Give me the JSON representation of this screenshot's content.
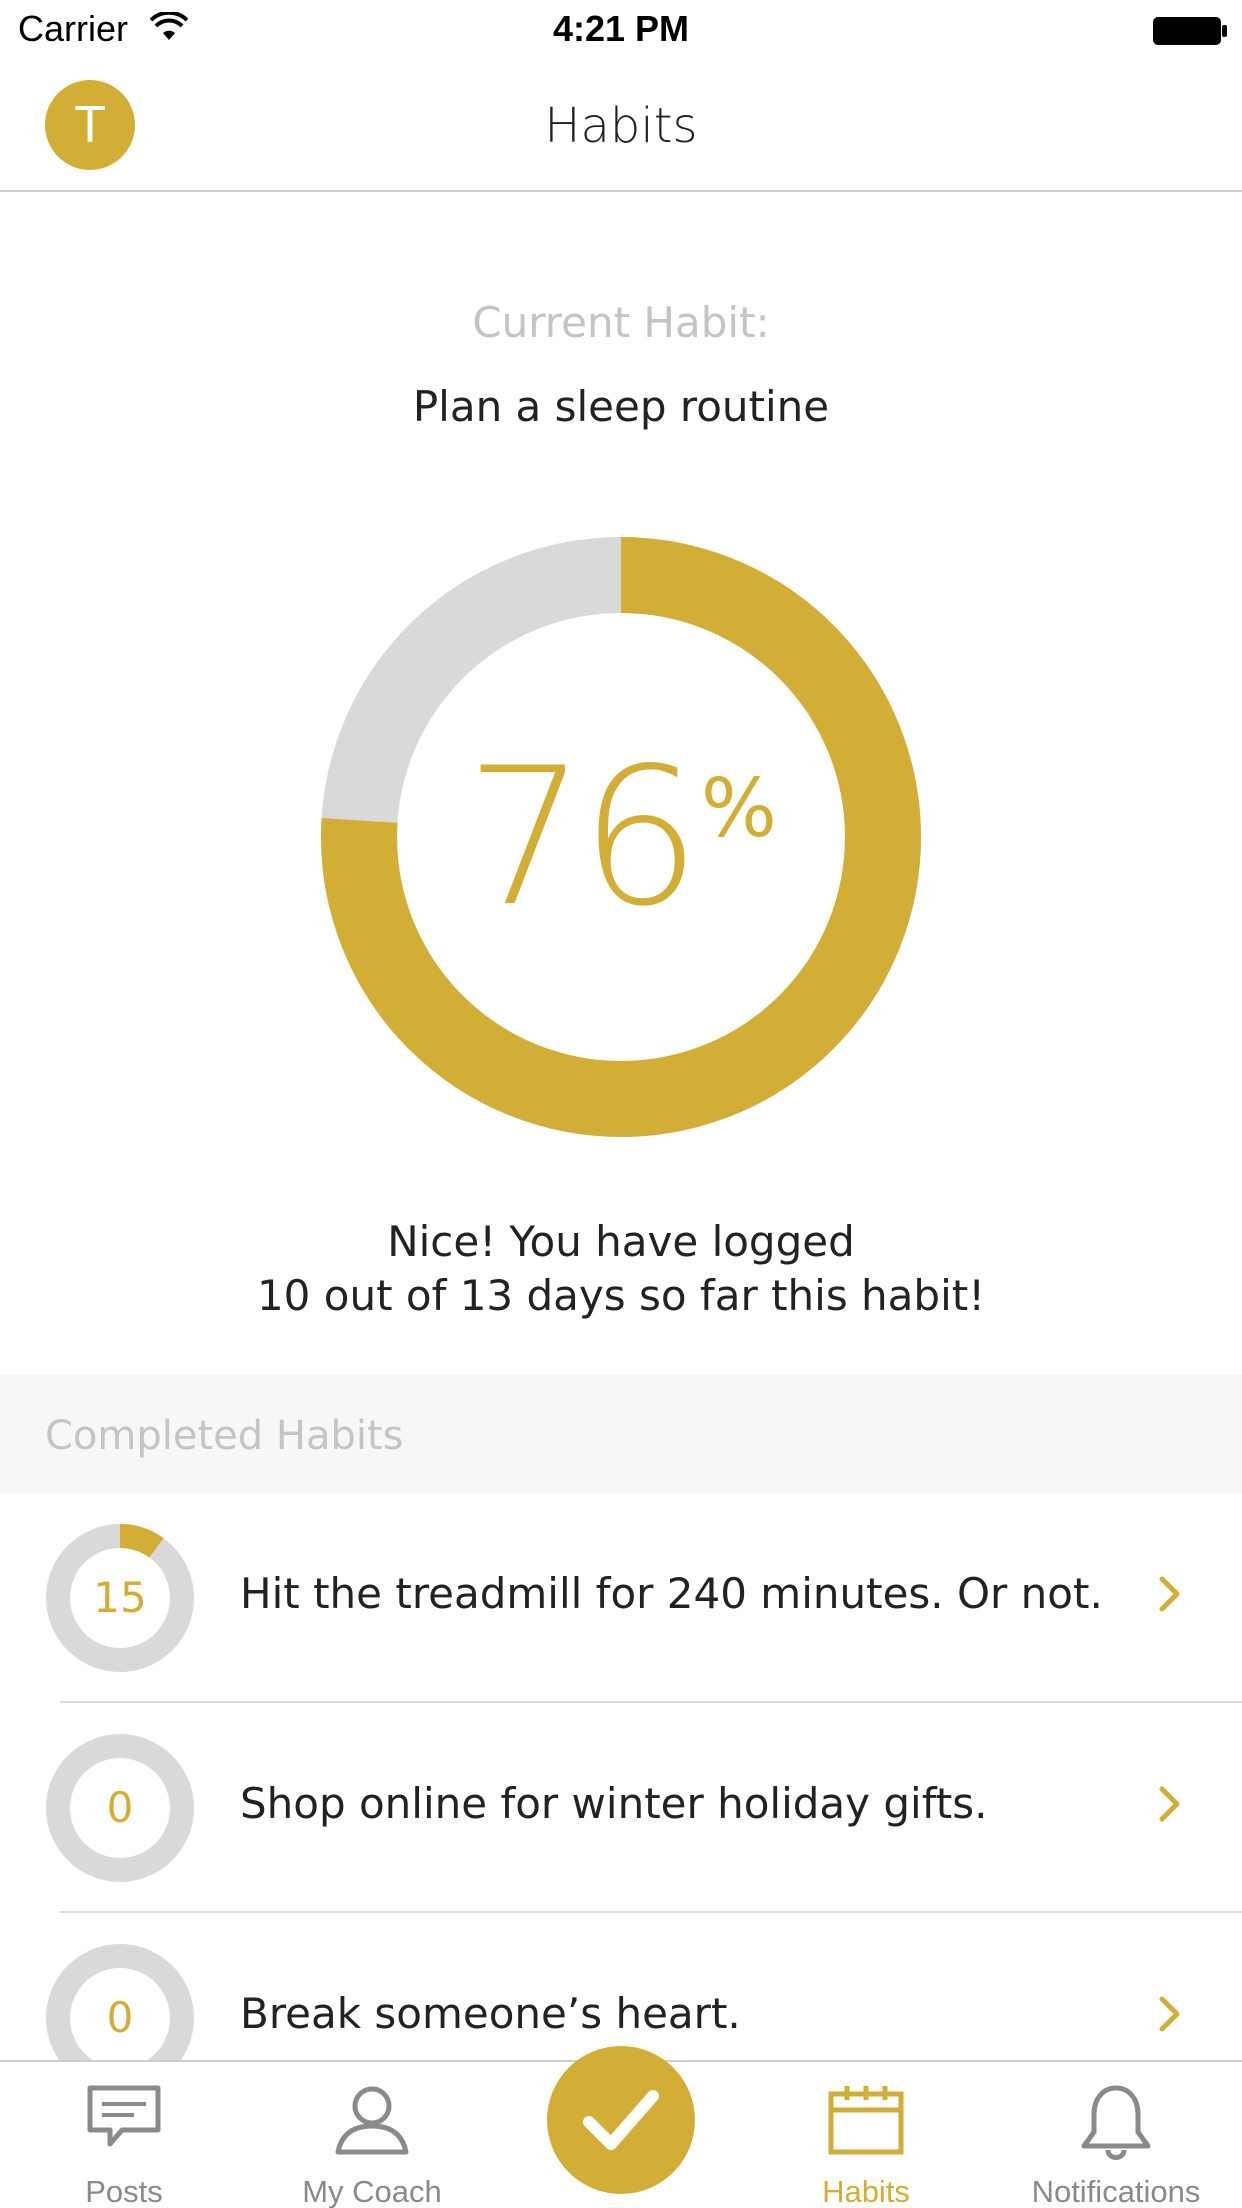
{
  "status_bar": {
    "carrier": "Carrier",
    "time": "4:21 PM"
  },
  "nav": {
    "avatar_initial": "T",
    "title": "Habits"
  },
  "current_habit": {
    "label": "Current Habit:",
    "name": "Plan a sleep routine",
    "percent_value": "76",
    "percent_sign": "%",
    "progress_fraction": 0.76,
    "summary_line1": "Nice! You have logged",
    "summary_line2": "10 out of 13 days so far this habit!"
  },
  "completed": {
    "header": "Completed Habits",
    "items": [
      {
        "count": "15",
        "text": "Hit the treadmill for 240 minutes. Or not.",
        "progress_fraction": 0.1
      },
      {
        "count": "0",
        "text": "Shop online for winter holiday gifts.",
        "progress_fraction": 0
      },
      {
        "count": "0",
        "text": "Break someone’s heart.",
        "progress_fraction": 0
      }
    ]
  },
  "tabs": [
    {
      "label": "Posts",
      "icon": "chat-icon",
      "active": false
    },
    {
      "label": "My Coach",
      "icon": "person-icon",
      "active": false
    },
    {
      "label": "Habits",
      "icon": "calendar-icon",
      "active": true
    },
    {
      "label": "Notifications",
      "icon": "bell-icon",
      "active": false
    }
  ],
  "colors": {
    "accent": "#d3ae37",
    "ring_track": "#d9d9d9",
    "muted_text": "#c4c4c4",
    "tab_inactive": "#8a8a8a"
  }
}
